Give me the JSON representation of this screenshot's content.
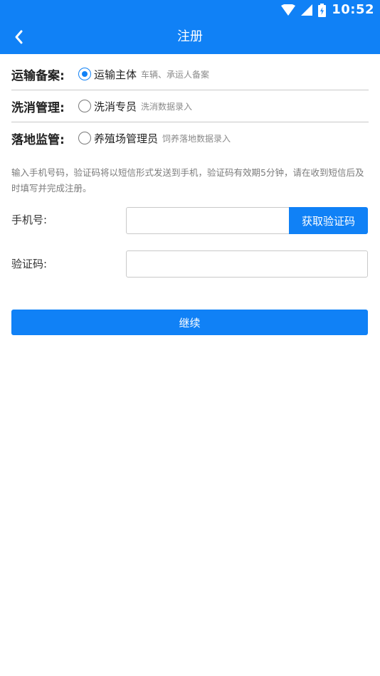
{
  "status_bar": {
    "time": "10:52"
  },
  "app_bar": {
    "title": "注册"
  },
  "roles": [
    {
      "label": "运输备案:",
      "name": "运输主体",
      "desc": "车辆、承运人备案",
      "checked": true
    },
    {
      "label": "洗消管理:",
      "name": "洗消专员",
      "desc": "洗消数据录入",
      "checked": false
    },
    {
      "label": "落地监管:",
      "name": "养殖场管理员",
      "desc": "饲养落地数据录入",
      "checked": false
    }
  ],
  "instruction": "输入手机号码，验证码将以短信形式发送到手机，验证码有效期5分钟，请在收到短信后及时填写并完成注册。",
  "form": {
    "phone_label": "手机号:",
    "phone_value": "",
    "get_code_label": "获取验证码",
    "code_label": "验证码:",
    "code_value": ""
  },
  "continue_label": "继续",
  "colors": {
    "primary": "#1081f6"
  }
}
